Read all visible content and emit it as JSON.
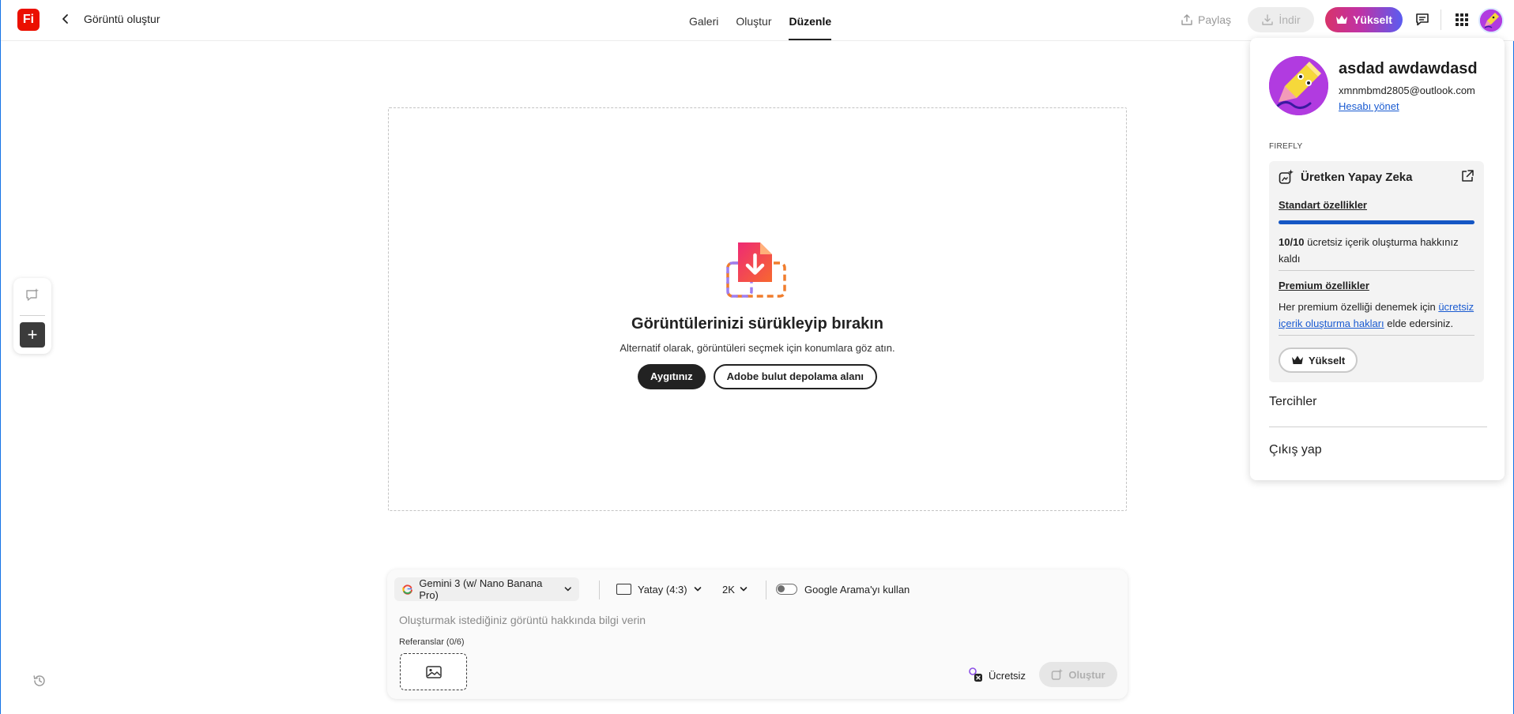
{
  "header": {
    "logo_text": "Fi",
    "title": "Görüntü oluştur",
    "tabs": [
      {
        "label": "Galeri"
      },
      {
        "label": "Oluştur"
      },
      {
        "label": "Düzenle"
      }
    ],
    "active_tab": "Düzenle",
    "share_label": "Paylaş",
    "download_label": "İndir",
    "upgrade_label": "Yükselt"
  },
  "dropzone": {
    "title": "Görüntülerinizi sürükleyip bırakın",
    "subtitle": "Alternatif olarak, görüntüleri seçmek için konumlara göz atın.",
    "device_button": "Aygıtınız",
    "cloud_button": "Adobe bulut depolama alanı"
  },
  "prompt": {
    "model": "Gemini 3 (w/ Nano Banana Pro)",
    "aspect_ratio": "Yatay (4:3)",
    "resolution": "2K",
    "google_search_label": "Google Arama'yı kullan",
    "google_search_enabled": false,
    "placeholder": "Oluşturmak istediğiniz görüntü hakkında bilgi verin",
    "references_label": "Referanslar (0/6)",
    "free_label": "Ücretsiz",
    "generate_label": "Oluştur"
  },
  "account": {
    "name": "asdad awdawdasd",
    "email": "xmnmbmd2805@outlook.com",
    "manage_link": "Hesabı yönet",
    "section_tag": "FIREFLY",
    "card": {
      "title": "Üretken Yapay Zeka",
      "standard_heading": "Standart özellikler",
      "standard_progress": 1.0,
      "credits_count": "10/10",
      "credits_text": " ücretsiz içerik oluşturma hakkınız kaldı",
      "premium_heading": "Premium özellikler",
      "premium_text_before": "Her premium özelliği denemek için ",
      "premium_link": "ücretsiz içerik oluşturma hakları",
      "premium_text_after": " elde edersiniz.",
      "upgrade_label": "Yükselt"
    },
    "preferences": "Tercihler",
    "sign_out": "Çıkış yap"
  },
  "colors": {
    "brand_red": "#eb1000",
    "link_blue": "#1a5bd1",
    "progress_blue": "#1456c4",
    "upgrade_gradient_start": "#d8336a",
    "upgrade_gradient_end": "#5a5cf0"
  }
}
